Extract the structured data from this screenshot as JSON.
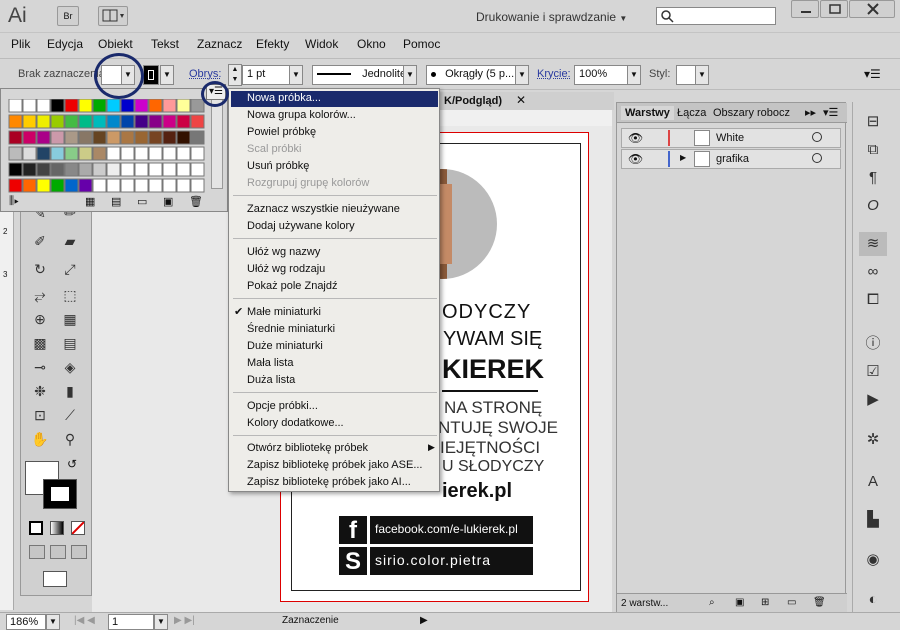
{
  "app": {
    "logo": "Ai",
    "bridge": "Br",
    "workspace": "Drukowanie i sprawdzanie"
  },
  "menu": [
    "Plik",
    "Edycja",
    "Obiekt",
    "Tekst",
    "Zaznacz",
    "Efekty",
    "Widok",
    "Okno",
    "Pomoc"
  ],
  "control": {
    "selection": "Brak zaznaczenia",
    "stroke_label": "Obrys:",
    "stroke_weight": "1 pt",
    "stroke_style": "Jednolite",
    "brush": "Okrągły (5 p...",
    "opacity_label": "Krycie:",
    "opacity": "100%",
    "style_label": "Styl:"
  },
  "doc_tab": "K/Podgląd)",
  "context_menu": {
    "g1": [
      "Nowa próbka...",
      "Nowa grupa kolorów...",
      "Powiel próbkę",
      "Scal próbki",
      "Usuń próbkę",
      "Rozgrupuj grupę kolorów"
    ],
    "g2": [
      "Zaznacz wszystkie nieużywane",
      "Dodaj używane kolory"
    ],
    "g3": [
      "Ułóż wg nazwy",
      "Ułóż wg rodzaju",
      "Pokaż pole Znajdź"
    ],
    "g4": [
      "Małe miniaturki",
      "Średnie miniaturki",
      "Duże miniaturki",
      "Mała lista",
      "Duża lista"
    ],
    "g5": [
      "Opcje próbki...",
      "Kolory dodatkowe..."
    ],
    "g6": [
      "Otwórz bibliotekę próbek",
      "Zapisz bibliotekę próbek jako ASE...",
      "Zapisz bibliotekę próbek jako AI..."
    ]
  },
  "artwork": {
    "l1": "ODYCZY",
    "l2": "YWAM SIĘ",
    "l3": "KIEREK",
    "l4": "NA STRONĘ",
    "l5": "NTUJĘ SWOJE",
    "l6": "IEJĘTNOŚCI",
    "l7": "U SŁODYCZY",
    "l8": "ierek.pl",
    "facebook": "facebook.com/e-lukierek.pl",
    "skype": "sirio.color.pietra",
    "fb_glyph": "f",
    "skype_glyph": "S"
  },
  "layers": {
    "tabs": [
      "Warstwy",
      "Łącza",
      "Obszary robocz"
    ],
    "items": [
      "White",
      "grafika"
    ],
    "count": "2 warstw..."
  },
  "status": {
    "zoom": "186%",
    "page": "1",
    "mode": "Zaznaczenie"
  },
  "colors": {
    "accent": "#1a2a6c",
    "artboard_border": "#dd0000"
  }
}
